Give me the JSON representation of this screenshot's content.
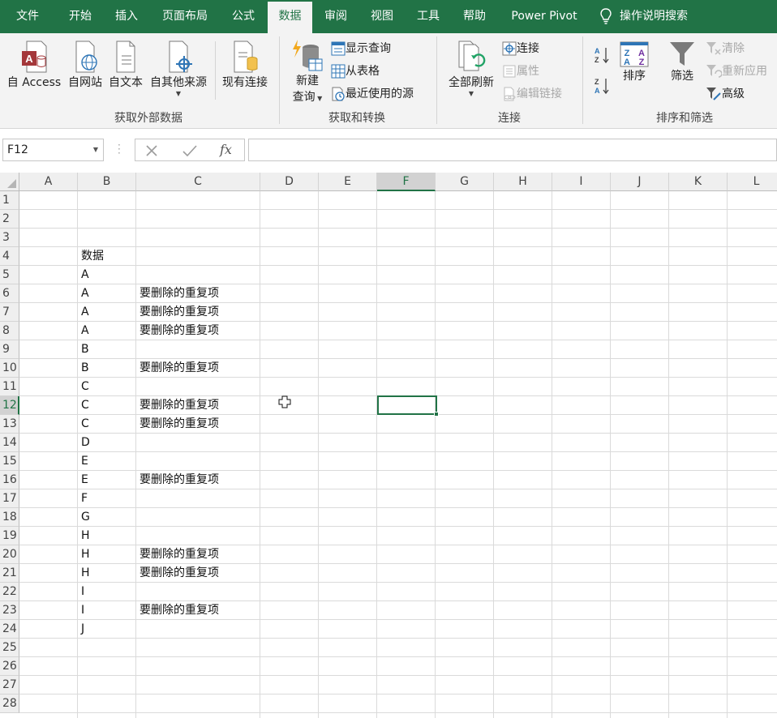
{
  "tabs": [
    {
      "label": "文件"
    },
    {
      "label": "开始"
    },
    {
      "label": "插入"
    },
    {
      "label": "页面布局"
    },
    {
      "label": "公式"
    },
    {
      "label": "数据"
    },
    {
      "label": "审阅"
    },
    {
      "label": "视图"
    },
    {
      "label": "工具"
    },
    {
      "label": "帮助"
    },
    {
      "label": "Power Pivot"
    }
  ],
  "active_tab": "数据",
  "tell_me": "操作说明搜索",
  "ribbon": {
    "get_external": {
      "label": "获取外部数据",
      "from_access": "自 Access",
      "from_web": "自网站",
      "from_text": "自文本",
      "from_other": "自其他来源",
      "existing": "现有连接"
    },
    "get_transform": {
      "label": "获取和转换",
      "new_query_1": "新建",
      "new_query_2": "查询",
      "show_queries": "显示查询",
      "from_table": "从表格",
      "recent_sources": "最近使用的源"
    },
    "connections": {
      "label": "连接",
      "refresh_all": "全部刷新",
      "connections": "连接",
      "properties": "属性",
      "edit_links": "编辑链接"
    },
    "sort_filter": {
      "label": "排序和筛选",
      "sort": "排序",
      "filter": "筛选",
      "clear": "清除",
      "reapply": "重新应用",
      "advanced": "高级"
    }
  },
  "formula_bar": {
    "name_box": "F12",
    "fx": "fx",
    "content": ""
  },
  "sheet": {
    "columns": [
      "A",
      "B",
      "C",
      "D",
      "E",
      "F",
      "G",
      "H",
      "I",
      "J",
      "K",
      "L"
    ],
    "selected_column": "F",
    "selected_row": 12,
    "rows": [
      1,
      2,
      3,
      4,
      5,
      6,
      7,
      8,
      9,
      10,
      11,
      12,
      13,
      14,
      15,
      16,
      17,
      18,
      19,
      20,
      21,
      22,
      23,
      24,
      25,
      26,
      27,
      28
    ],
    "cells": [
      {
        "ref": "B4",
        "row": 4,
        "col": "B",
        "value": "数据"
      },
      {
        "ref": "B5",
        "row": 5,
        "col": "B",
        "value": "A"
      },
      {
        "ref": "B6",
        "row": 6,
        "col": "B",
        "value": "A"
      },
      {
        "ref": "C6",
        "row": 6,
        "col": "C",
        "value": "要删除的重复项"
      },
      {
        "ref": "B7",
        "row": 7,
        "col": "B",
        "value": "A"
      },
      {
        "ref": "C7",
        "row": 7,
        "col": "C",
        "value": "要删除的重复项"
      },
      {
        "ref": "B8",
        "row": 8,
        "col": "B",
        "value": "A"
      },
      {
        "ref": "C8",
        "row": 8,
        "col": "C",
        "value": "要删除的重复项"
      },
      {
        "ref": "B9",
        "row": 9,
        "col": "B",
        "value": "B"
      },
      {
        "ref": "B10",
        "row": 10,
        "col": "B",
        "value": "B"
      },
      {
        "ref": "C10",
        "row": 10,
        "col": "C",
        "value": "要删除的重复项"
      },
      {
        "ref": "B11",
        "row": 11,
        "col": "B",
        "value": "C"
      },
      {
        "ref": "B12",
        "row": 12,
        "col": "B",
        "value": "C"
      },
      {
        "ref": "C12",
        "row": 12,
        "col": "C",
        "value": "要删除的重复项"
      },
      {
        "ref": "B13",
        "row": 13,
        "col": "B",
        "value": "C"
      },
      {
        "ref": "C13",
        "row": 13,
        "col": "C",
        "value": "要删除的重复项"
      },
      {
        "ref": "B14",
        "row": 14,
        "col": "B",
        "value": "D"
      },
      {
        "ref": "B15",
        "row": 15,
        "col": "B",
        "value": "E"
      },
      {
        "ref": "B16",
        "row": 16,
        "col": "B",
        "value": "E"
      },
      {
        "ref": "C16",
        "row": 16,
        "col": "C",
        "value": "要删除的重复项"
      },
      {
        "ref": "B17",
        "row": 17,
        "col": "B",
        "value": "F"
      },
      {
        "ref": "B18",
        "row": 18,
        "col": "B",
        "value": "G"
      },
      {
        "ref": "B19",
        "row": 19,
        "col": "B",
        "value": "H"
      },
      {
        "ref": "B20",
        "row": 20,
        "col": "B",
        "value": "H"
      },
      {
        "ref": "C20",
        "row": 20,
        "col": "C",
        "value": "要删除的重复项"
      },
      {
        "ref": "B21",
        "row": 21,
        "col": "B",
        "value": "H"
      },
      {
        "ref": "C21",
        "row": 21,
        "col": "C",
        "value": "要删除的重复项"
      },
      {
        "ref": "B22",
        "row": 22,
        "col": "B",
        "value": "I"
      },
      {
        "ref": "B23",
        "row": 23,
        "col": "B",
        "value": "I"
      },
      {
        "ref": "C23",
        "row": 23,
        "col": "C",
        "value": "要删除的重复项"
      },
      {
        "ref": "B24",
        "row": 24,
        "col": "B",
        "value": "J"
      }
    ]
  },
  "colors": {
    "accent": "#217346",
    "ribbon_bg": "#f3f3f3"
  }
}
